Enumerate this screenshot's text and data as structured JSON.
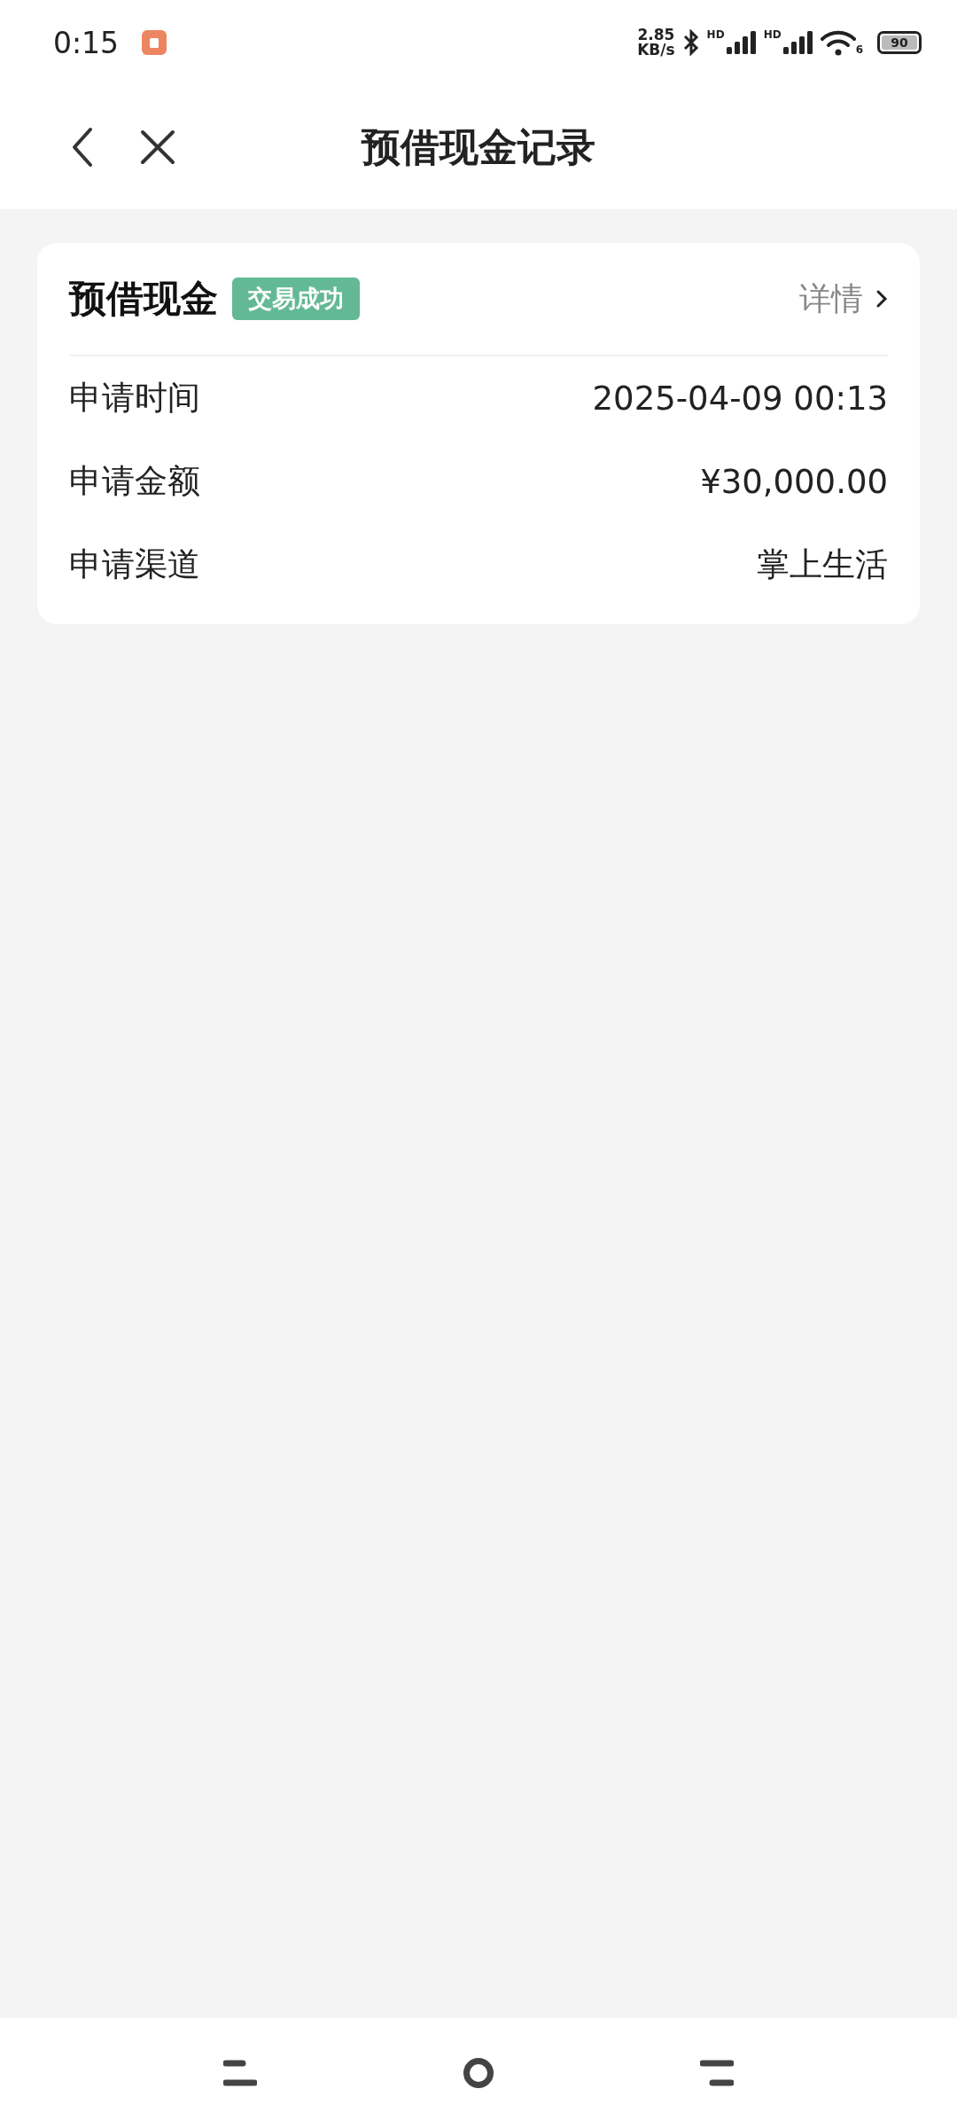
{
  "status_bar": {
    "time": "0:15",
    "speed_value": "2.85",
    "speed_unit": "KB/s",
    "signal_labels": [
      "HD",
      "HD"
    ],
    "wifi_label": "6",
    "battery": "90"
  },
  "header": {
    "title": "预借现金记录"
  },
  "record": {
    "title": "预借现金",
    "status": "交易成功",
    "detail_link": "详情",
    "rows": [
      {
        "label": "申请时间",
        "value": "2025-04-09 00:13"
      },
      {
        "label": "申请金额",
        "value": "¥30,000.00"
      },
      {
        "label": "申请渠道",
        "value": "掌上生活"
      }
    ]
  }
}
